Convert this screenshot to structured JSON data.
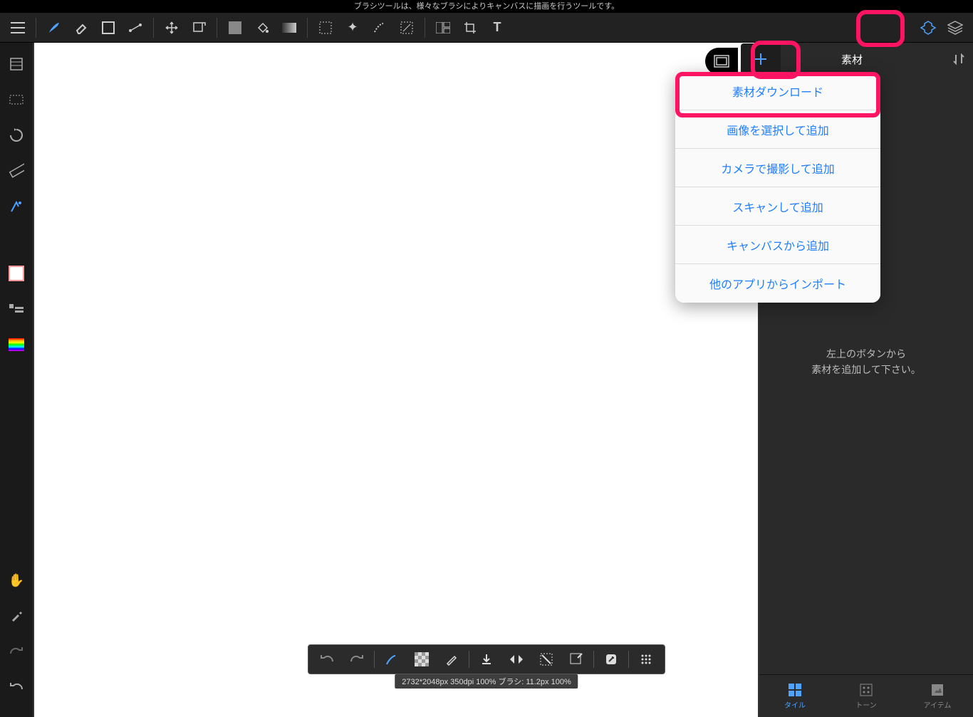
{
  "tooltip": "ブラシツールは、様々なブラシによりキャンバスに描画を行うツールです。",
  "right_panel": {
    "title": "素材",
    "empty_line1": "左上のボタンから",
    "empty_line2": "素材を追加して下さい。",
    "tabs": {
      "tile": "タイル",
      "tone": "トーン",
      "item": "アイテム"
    }
  },
  "dropdown": {
    "download": "素材ダウンロード",
    "select_image": "画像を選択して追加",
    "camera": "カメラで撮影して追加",
    "scan": "スキャンして追加",
    "from_canvas": "キャンバスから追加",
    "import": "他のアプリからインポート"
  },
  "status": "2732*2048px 350dpi 100% ブラシ: 11.2px 100%"
}
